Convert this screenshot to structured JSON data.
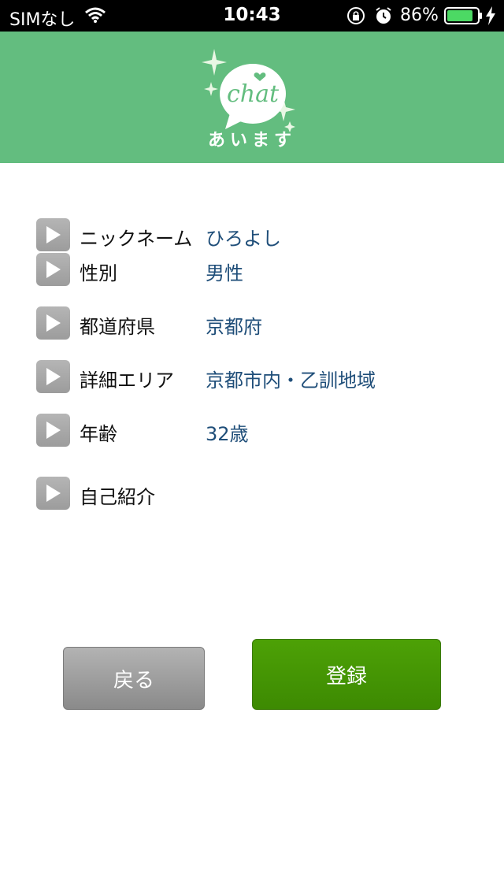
{
  "status_bar": {
    "carrier": "SIMなし",
    "time": "10:43",
    "battery_percent": "86%",
    "battery_level": 0.86
  },
  "header": {
    "logo_word": "chat",
    "logo_text": "あいます",
    "background_color": "#63bd7f"
  },
  "profile": {
    "rows": [
      {
        "label": "ニックネーム",
        "value": "ひろよし"
      },
      {
        "label": "性別",
        "value": "男性"
      },
      {
        "label": "都道府県",
        "value": "京都府"
      },
      {
        "label": "詳細エリア",
        "value": "京都市内・乙訓地域"
      },
      {
        "label": "年齢",
        "value": "32歳"
      },
      {
        "label": "自己紹介",
        "value": ""
      }
    ]
  },
  "buttons": {
    "back_label": "戻る",
    "register_label": "登録"
  },
  "colors": {
    "value_text": "#1f4e79",
    "register_button": "#4a9a05",
    "back_button": "#9c9c9c"
  }
}
